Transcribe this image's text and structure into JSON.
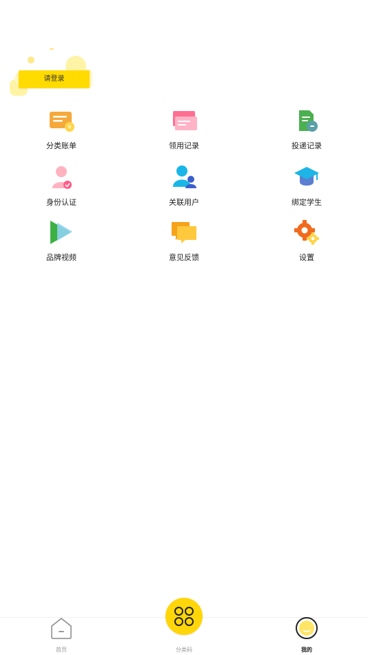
{
  "header": {
    "login_label": "请登录"
  },
  "menu": {
    "items": [
      {
        "label": "分类账单",
        "icon": "bill-icon"
      },
      {
        "label": "领用记录",
        "icon": "receive-record-icon"
      },
      {
        "label": "投递记录",
        "icon": "delivery-record-icon"
      },
      {
        "label": "身份认证",
        "icon": "identity-verify-icon"
      },
      {
        "label": "关联用户",
        "icon": "linked-users-icon"
      },
      {
        "label": "绑定学生",
        "icon": "graduation-cap-icon"
      },
      {
        "label": "品牌视频",
        "icon": "play-icon"
      },
      {
        "label": "意见反馈",
        "icon": "feedback-icon"
      },
      {
        "label": "设置",
        "icon": "settings-gear-icon"
      }
    ]
  },
  "tabbar": {
    "home_label": "首页",
    "code_label": "分类码",
    "mine_label": "我的"
  },
  "colors": {
    "accent": "#ffd60a",
    "login_yellow": "#ffdb00"
  }
}
